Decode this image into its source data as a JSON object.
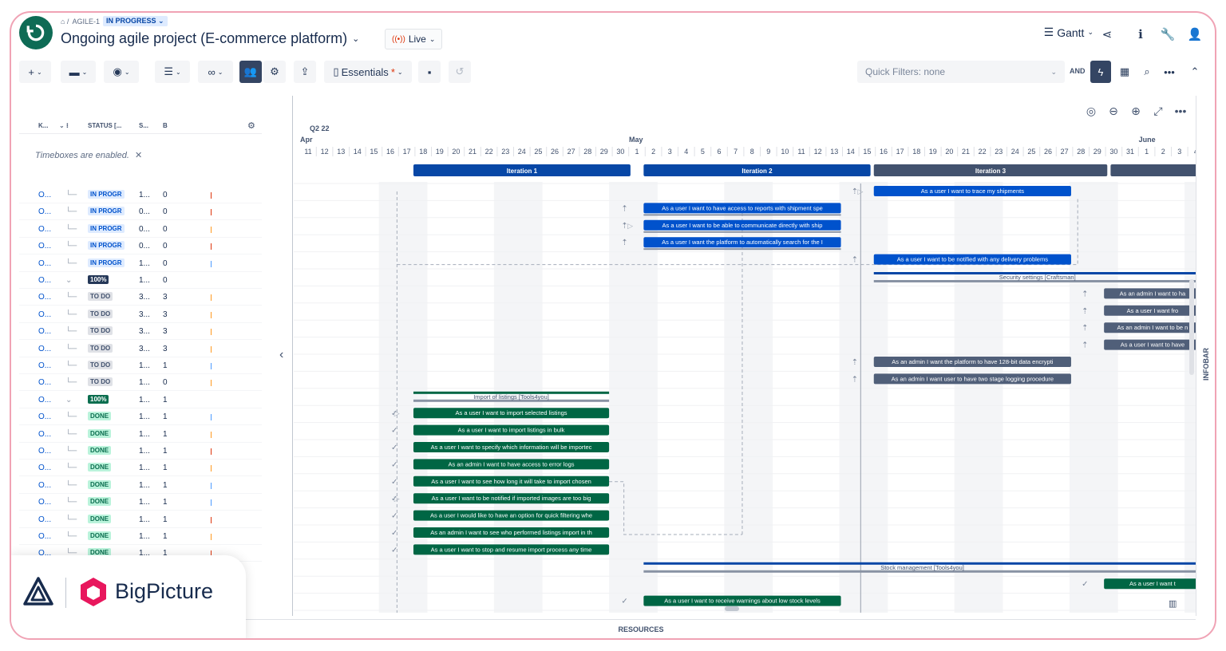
{
  "breadcrumb": {
    "project_key": "AGILE-1",
    "status": "IN PROGRESS"
  },
  "header": {
    "title": "Ongoing agile project (E-commerce platform)",
    "live_label": "Live",
    "view_label": "Gantt"
  },
  "toolbar": {
    "view_preset": "Essentials",
    "quick_filters": "Quick Filters: none",
    "and_label": "AND"
  },
  "left_pane": {
    "columns": [
      "K...",
      "STATUS [...",
      "S...",
      "B"
    ],
    "timebox_note": "Timeboxes are enabled.",
    "rows": [
      {
        "key": "O...",
        "status": "IN PROGR",
        "s": "1...",
        "b": "0",
        "kind": "prog",
        "tick": "#de350b"
      },
      {
        "key": "O...",
        "status": "IN PROGR",
        "s": "0...",
        "b": "0",
        "kind": "prog",
        "tick": "#de350b"
      },
      {
        "key": "O...",
        "status": "IN PROGR",
        "s": "0...",
        "b": "0",
        "kind": "prog",
        "tick": "#ff991f"
      },
      {
        "key": "O...",
        "status": "IN PROGR",
        "s": "0...",
        "b": "0",
        "kind": "prog",
        "tick": "#de350b"
      },
      {
        "key": "O...",
        "status": "IN PROGR",
        "s": "1...",
        "b": "0",
        "kind": "prog",
        "tick": "#4c9aff"
      },
      {
        "key": "O...",
        "status": "100%",
        "s": "1...",
        "b": "0",
        "kind": "pct",
        "tick": ""
      },
      {
        "key": "O...",
        "status": "TO DO",
        "s": "3...",
        "b": "3",
        "kind": "todo",
        "tick": "#ff991f"
      },
      {
        "key": "O...",
        "status": "TO DO",
        "s": "3...",
        "b": "3",
        "kind": "todo",
        "tick": "#ff991f"
      },
      {
        "key": "O...",
        "status": "TO DO",
        "s": "3...",
        "b": "3",
        "kind": "todo",
        "tick": "#ff991f"
      },
      {
        "key": "O...",
        "status": "TO DO",
        "s": "3...",
        "b": "3",
        "kind": "todo",
        "tick": "#ff991f"
      },
      {
        "key": "O...",
        "status": "TO DO",
        "s": "1...",
        "b": "1",
        "kind": "todo",
        "tick": "#4c9aff"
      },
      {
        "key": "O...",
        "status": "TO DO",
        "s": "1...",
        "b": "0",
        "kind": "todo",
        "tick": "#ff991f"
      },
      {
        "key": "O...",
        "status": "100%",
        "s": "1...",
        "b": "1",
        "kind": "pctg",
        "tick": ""
      },
      {
        "key": "O...",
        "status": "DONE",
        "s": "1...",
        "b": "1",
        "kind": "done",
        "tick": "#4c9aff"
      },
      {
        "key": "O...",
        "status": "DONE",
        "s": "1...",
        "b": "1",
        "kind": "done",
        "tick": "#ff991f"
      },
      {
        "key": "O...",
        "status": "DONE",
        "s": "1...",
        "b": "1",
        "kind": "done",
        "tick": "#de350b"
      },
      {
        "key": "O...",
        "status": "DONE",
        "s": "1...",
        "b": "1",
        "kind": "done",
        "tick": "#ff991f"
      },
      {
        "key": "O...",
        "status": "DONE",
        "s": "1...",
        "b": "1",
        "kind": "done",
        "tick": "#4c9aff"
      },
      {
        "key": "O...",
        "status": "DONE",
        "s": "1...",
        "b": "1",
        "kind": "done",
        "tick": "#4c9aff"
      },
      {
        "key": "O...",
        "status": "DONE",
        "s": "1...",
        "b": "1",
        "kind": "done",
        "tick": "#de350b"
      },
      {
        "key": "O...",
        "status": "DONE",
        "s": "1...",
        "b": "1",
        "kind": "done",
        "tick": "#ff991f"
      },
      {
        "key": "O...",
        "status": "DONE",
        "s": "1...",
        "b": "1",
        "kind": "done",
        "tick": "#de350b"
      }
    ]
  },
  "timeline": {
    "quarter": "Q2 22",
    "months": [
      {
        "label": "Apr",
        "day_index": 0
      },
      {
        "label": "May",
        "day_index": 20
      },
      {
        "label": "June",
        "day_index": 51
      }
    ],
    "days": [
      "11",
      "12",
      "13",
      "14",
      "15",
      "16",
      "17",
      "18",
      "19",
      "20",
      "21",
      "22",
      "23",
      "24",
      "25",
      "26",
      "27",
      "28",
      "29",
      "30",
      "1",
      "2",
      "3",
      "4",
      "5",
      "6",
      "7",
      "8",
      "9",
      "10",
      "11",
      "12",
      "13",
      "14",
      "15",
      "16",
      "17",
      "18",
      "19",
      "20",
      "21",
      "22",
      "23",
      "24",
      "25",
      "26",
      "27",
      "28",
      "29",
      "30",
      "31",
      "1",
      "2",
      "3",
      "4"
    ],
    "weekend_day_indices": [
      5,
      6,
      12,
      13,
      19,
      20,
      26,
      27,
      33,
      34,
      40,
      41,
      47,
      48,
      54
    ],
    "iterations": [
      {
        "label": "Iteration 1",
        "start": 6.6,
        "end": 19.8
      },
      {
        "label": "Iteration 2",
        "start": 20.6,
        "end": 34.4
      },
      {
        "label": "Iteration 3",
        "start": 34.6,
        "end": 48.8
      },
      {
        "label": "",
        "start": 49,
        "end": 55
      }
    ],
    "groups": [
      {
        "label": "Security settings [Craftsman]",
        "row": 5,
        "start": 34.6,
        "end": 54.5
      },
      {
        "label": "Import of listings [Tools4you]",
        "row": 12,
        "start": 6.6,
        "end": 18.5
      },
      {
        "label": "Stock management [Tools4you]",
        "row": 22,
        "start": 20.6,
        "end": 54.5
      }
    ],
    "tasks": [
      {
        "label": "As a user I want to trace my shipments",
        "row": 0,
        "start": 34.6,
        "end": 46.6,
        "color": "blue"
      },
      {
        "label": "As a user I want to have access to reports with shipment spe",
        "row": 1,
        "start": 20.6,
        "end": 32.6,
        "color": "blue"
      },
      {
        "label": "As a user I want to be able to communicate directly with ship",
        "row": 2,
        "start": 20.6,
        "end": 32.6,
        "color": "blue"
      },
      {
        "label": "As a user I want the platform to automatically search for the I",
        "row": 3,
        "start": 20.6,
        "end": 32.6,
        "color": "blue"
      },
      {
        "label": "As a user I want to be notified with any delivery problems",
        "row": 4,
        "start": 34.6,
        "end": 46.6,
        "color": "blue"
      },
      {
        "label": "As an admin I want to ha",
        "row": 6,
        "start": 48.6,
        "end": 54.5,
        "color": "slate"
      },
      {
        "label": "As a user I want fro",
        "row": 7,
        "start": 48.6,
        "end": 54.5,
        "color": "slate"
      },
      {
        "label": "As an admin I want to be n",
        "row": 8,
        "start": 48.6,
        "end": 54.5,
        "color": "slate"
      },
      {
        "label": "As a user I want to have",
        "row": 9,
        "start": 48.6,
        "end": 54.5,
        "color": "slate"
      },
      {
        "label": "As an admin I want the platform to have 128-bit data encrypti",
        "row": 10,
        "start": 34.6,
        "end": 46.6,
        "color": "slate"
      },
      {
        "label": "As an admin I want user to have two stage logging procedure",
        "row": 11,
        "start": 34.6,
        "end": 46.6,
        "color": "slate"
      },
      {
        "label": "As a user I want to import selected listings",
        "row": 13,
        "start": 6.6,
        "end": 18.5,
        "color": "green"
      },
      {
        "label": "As a user I want to import listings in bulk",
        "row": 14,
        "start": 6.6,
        "end": 18.5,
        "color": "green"
      },
      {
        "label": "As a user I want to specify which information will be importec",
        "row": 15,
        "start": 6.6,
        "end": 18.5,
        "color": "green"
      },
      {
        "label": "As an admin I want to have access to error logs",
        "row": 16,
        "start": 6.6,
        "end": 18.5,
        "color": "green"
      },
      {
        "label": "As a user I want to see how long it will take to import chosen",
        "row": 17,
        "start": 6.6,
        "end": 18.5,
        "color": "green"
      },
      {
        "label": "As a user I want to be notified if imported images are too big",
        "row": 18,
        "start": 6.6,
        "end": 18.5,
        "color": "green"
      },
      {
        "label": "As a user I would like to have an option for quick filtering whe",
        "row": 19,
        "start": 6.6,
        "end": 18.5,
        "color": "green"
      },
      {
        "label": "As an admin I want to see who performed listings import in th",
        "row": 20,
        "start": 6.6,
        "end": 18.5,
        "color": "green"
      },
      {
        "label": "As a user I want to stop and resume import process any time",
        "row": 21,
        "start": 6.6,
        "end": 18.5,
        "color": "green"
      },
      {
        "label": "As a user I want t",
        "row": 23,
        "start": 48.6,
        "end": 54.5,
        "color": "green"
      },
      {
        "label": "As a user I want to receive warnings about low stock levels",
        "row": 24,
        "start": 20.6,
        "end": 32.6,
        "color": "green"
      }
    ],
    "infobar_label": "INFOBAR",
    "resources_label": "RESOURCES"
  },
  "colors": {
    "blue": "#0747a6",
    "green": "#006644",
    "slate": "#42526e",
    "accent": "#344563",
    "brand": "#e8175d"
  },
  "promo": {
    "brand": "BigPicture"
  }
}
